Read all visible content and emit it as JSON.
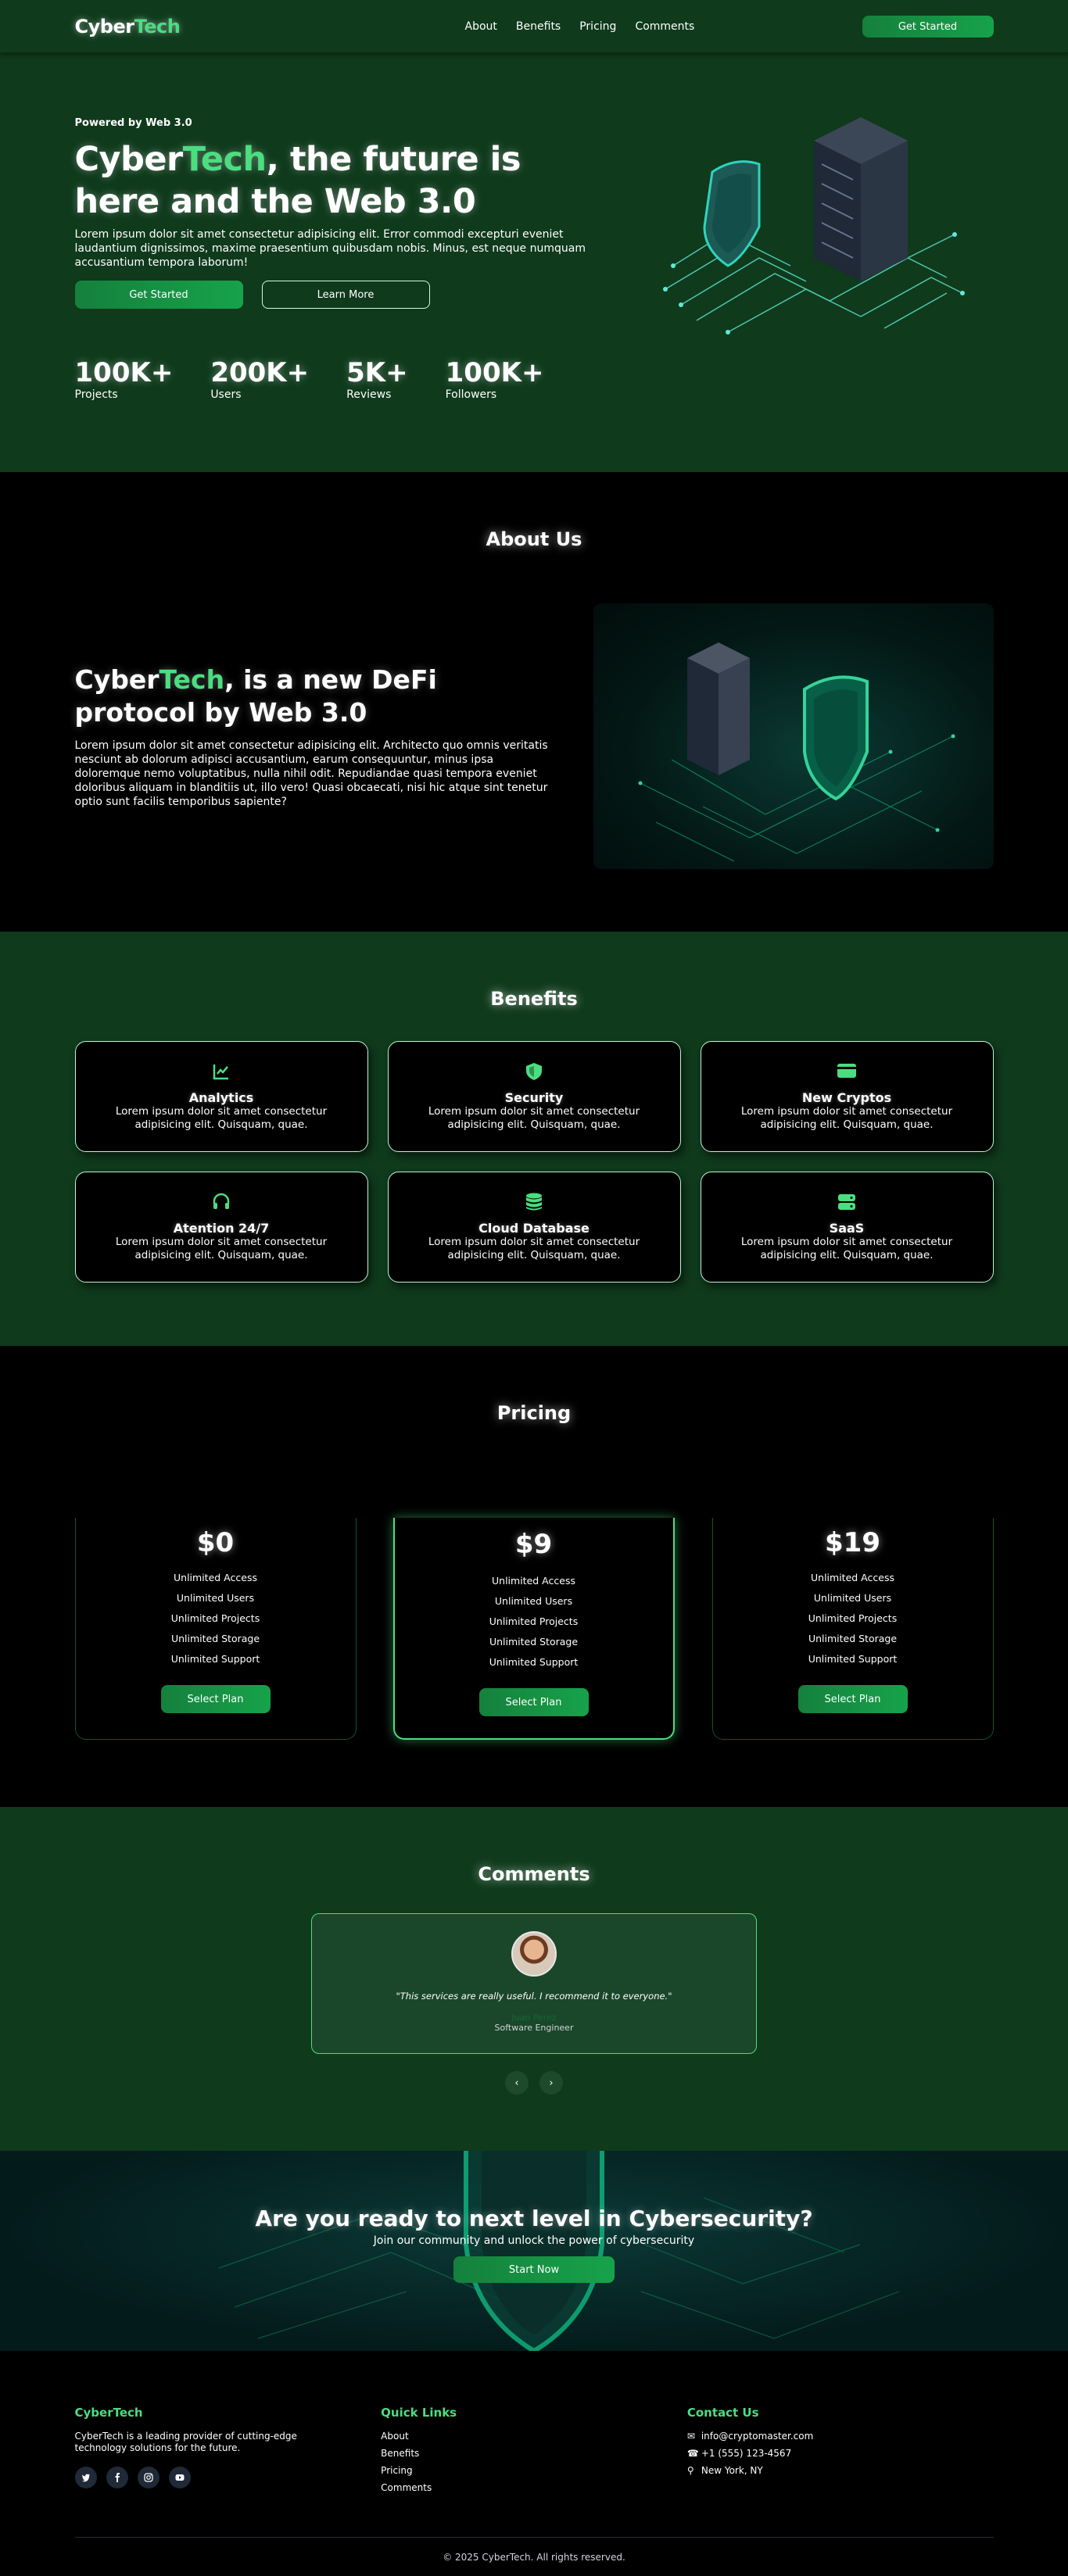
{
  "nav": {
    "logo_a": "Cyber",
    "logo_b": "Tech",
    "links": [
      "About",
      "Benefits",
      "Pricing",
      "Comments"
    ],
    "cta": "Get Started"
  },
  "hero": {
    "powered": "Powered by Web 3.0",
    "title_a": "Cyber",
    "title_b": "Tech",
    "title_c": ", the future is here and the Web 3.0",
    "lead": "Lorem ipsum dolor sit amet consectetur adipisicing elit. Error commodi excepturi eveniet laudantium dignissimos, maxime praesentium quibusdam nobis. Minus, est neque numquam accusantium tempora laborum!",
    "primary": "Get Started",
    "secondary": "Learn More",
    "stats": [
      {
        "num": "100K+",
        "label": "Projects"
      },
      {
        "num": "200K+",
        "label": "Users"
      },
      {
        "num": "5K+",
        "label": "Reviews"
      },
      {
        "num": "100K+",
        "label": "Followers"
      }
    ]
  },
  "about": {
    "title": "About Us",
    "heading_a": "Cyber",
    "heading_b": "Tech",
    "heading_c": ", is a new DeFi protocol by Web 3.0",
    "text": "Lorem ipsum dolor sit amet consectetur adipisicing elit. Architecto quo omnis veritatis nesciunt ab dolorum adipisci accusantium, earum consequuntur, minus ipsa doloremque nemo voluptatibus, nulla nihil odit. Repudiandae quasi tempora eveniet doloribus aliquam in blanditiis ut, illo vero! Quasi obcaecati, nisi hic atque sint tenetur optio sunt facilis temporibus sapiente?"
  },
  "benefits": {
    "title": "Benefits",
    "items": [
      {
        "icon": "chart-line-icon",
        "title": "Analytics",
        "text": "Lorem ipsum dolor sit amet consectetur adipisicing elit. Quisquam, quae."
      },
      {
        "icon": "shield-icon",
        "title": "Security",
        "text": "Lorem ipsum dolor sit amet consectetur adipisicing elit. Quisquam, quae."
      },
      {
        "icon": "credit-card-icon",
        "title": "New Cryptos",
        "text": "Lorem ipsum dolor sit amet consectetur adipisicing elit. Quisquam, quae."
      },
      {
        "icon": "headset-icon",
        "title": "Atention 24/7",
        "text": "Lorem ipsum dolor sit amet consectetur adipisicing elit. Quisquam, quae."
      },
      {
        "icon": "database-icon",
        "title": "Cloud Database",
        "text": "Lorem ipsum dolor sit amet consectetur adipisicing elit. Quisquam, quae."
      },
      {
        "icon": "server-icon",
        "title": "SaaS",
        "text": "Lorem ipsum dolor sit amet consectetur adipisicing elit. Quisquam, quae."
      }
    ]
  },
  "pricing": {
    "title": "Pricing",
    "plans": [
      {
        "price": "$0",
        "features": [
          "Unlimited Access",
          "Unlimited Users",
          "Unlimited Projects",
          "Unlimited Storage",
          "Unlimited Support"
        ],
        "button": "Select Plan"
      },
      {
        "price": "$9",
        "features": [
          "Unlimited Access",
          "Unlimited Users",
          "Unlimited Projects",
          "Unlimited Storage",
          "Unlimited Support"
        ],
        "button": "Select Plan"
      },
      {
        "price": "$19",
        "features": [
          "Unlimited Access",
          "Unlimited Users",
          "Unlimited Projects",
          "Unlimited Storage",
          "Unlimited Support"
        ],
        "button": "Select Plan"
      }
    ]
  },
  "comments": {
    "title": "Comments",
    "quote": "\"This services are really useful. I recommend it to everyone.\"",
    "author": "Juan Perez",
    "role": "Software Engineer",
    "prev": "‹",
    "next": "›"
  },
  "cta": {
    "title": "Are you ready to next level in Cybersecurity?",
    "text": "Join our community and unlock the power of cybersecurity",
    "button": "Start Now"
  },
  "footer": {
    "brand": "CyberTech",
    "desc": "CyberTech is a leading provider of cutting-edge technology solutions for the future.",
    "social": [
      "twitter-icon",
      "facebook-icon",
      "instagram-icon",
      "youtube-icon"
    ],
    "links_title": "Quick Links",
    "links": [
      "About",
      "Benefits",
      "Pricing",
      "Comments"
    ],
    "contact_title": "Contact Us",
    "email": "info@cryptomaster.com",
    "phone": "+1 (555) 123-4567",
    "location": "New York, NY",
    "copyright": "© 2025 CyberTech. All rights reserved."
  },
  "colors": {
    "accent": "#4ade80",
    "bg_green": "#0f3a1c",
    "button": "#16a34a"
  }
}
